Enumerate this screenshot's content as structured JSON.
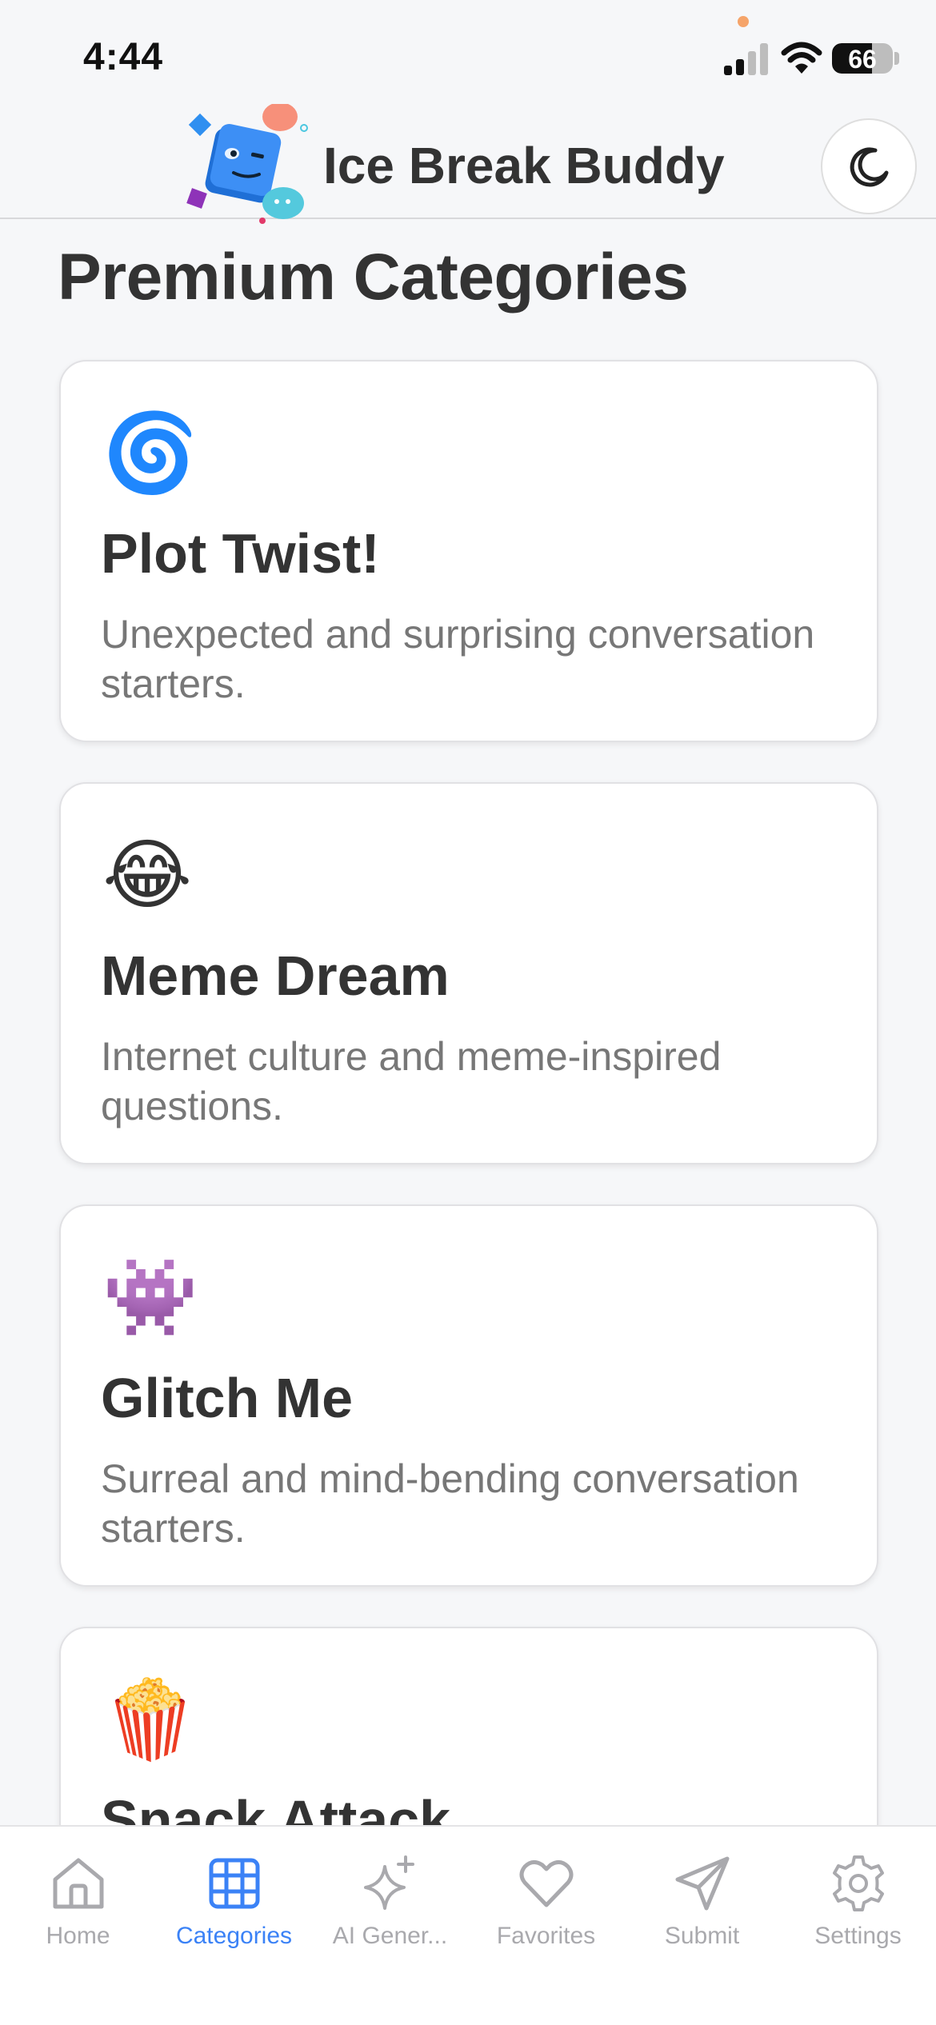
{
  "status_bar": {
    "time": "4:44",
    "battery": "66"
  },
  "header": {
    "app_title": "Ice Break Buddy",
    "theme_toggle_icon": "moon-icon"
  },
  "page_title": "Premium Categories",
  "categories": [
    {
      "emoji": "🌀",
      "icon": "cyclone-icon",
      "title": "Plot Twist!",
      "description": "Unexpected and surprising conversation starters."
    },
    {
      "emoji": "😂",
      "icon": "laughing-face-icon",
      "title": "Meme Dream",
      "description": "Internet culture and meme-inspired questions."
    },
    {
      "emoji": "👾",
      "icon": "alien-monster-icon",
      "title": "Glitch Me",
      "description": "Surreal and mind-bending conversation starters."
    },
    {
      "emoji": "🍿",
      "icon": "popcorn-icon",
      "title": "Snack Attack",
      "description": ""
    }
  ],
  "tab_bar": {
    "active": "Categories",
    "tabs": [
      {
        "label": "Home",
        "icon": "home-icon"
      },
      {
        "label": "Categories",
        "icon": "grid-icon"
      },
      {
        "label": "AI Gener...",
        "icon": "sparkles-icon"
      },
      {
        "label": "Favorites",
        "icon": "heart-icon"
      },
      {
        "label": "Submit",
        "icon": "send-icon"
      },
      {
        "label": "Settings",
        "icon": "gear-icon"
      }
    ]
  },
  "colors": {
    "accent": "#3b82f6",
    "inactive": "#a9a9ad",
    "background": "#f6f7f9",
    "card": "#ffffff"
  }
}
